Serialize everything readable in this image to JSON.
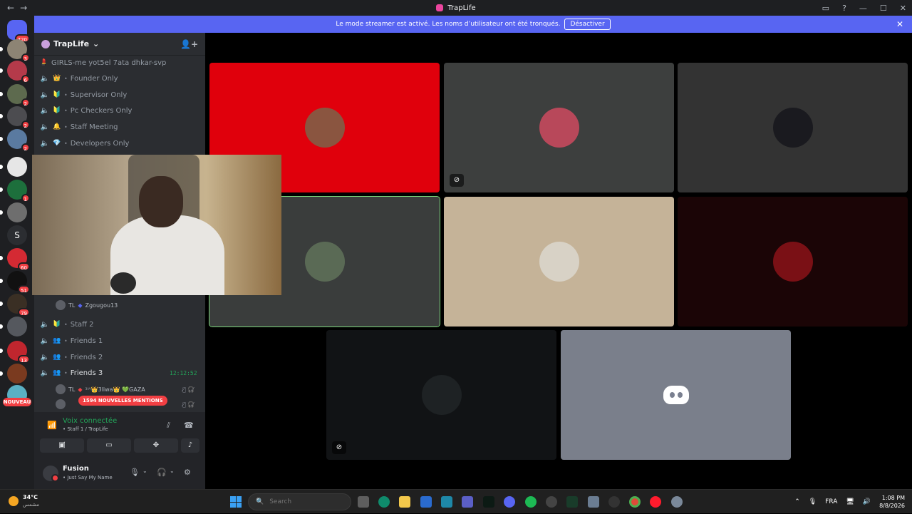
{
  "window": {
    "title": "TrapLife",
    "back": "←",
    "forward": "→",
    "controls": [
      "▭",
      "?",
      "—",
      "☐",
      "✕"
    ]
  },
  "banner": {
    "text": "Le mode streamer est activé. Les noms d’utilisateur ont été tronqués.",
    "button": "Désactiver",
    "close": "✕"
  },
  "servers": {
    "home_badge": "720",
    "new_label": "NOUVEAU",
    "letter": "S",
    "badges": [
      "3",
      "6",
      "2",
      "2",
      "2",
      "1",
      "60",
      "51",
      "79",
      "13"
    ]
  },
  "guild": {
    "name": "TrapLife",
    "chevron": "⌄",
    "channels": [
      {
        "emoji": "💄",
        "name": "GIRLS-me yot5el 7ata dhkar-svp",
        "no_voice": true
      },
      {
        "emoji": "👑",
        "name": "Founder Only"
      },
      {
        "emoji": "🔰",
        "name": "Supervisor Only"
      },
      {
        "emoji": "🔰",
        "name": "Pc Checkers Only"
      },
      {
        "emoji": "🔔",
        "name": "Staff Meeting"
      },
      {
        "emoji": "💎",
        "name": "Developers Only"
      },
      {
        "emoji": "🔰",
        "name": "Staff 2"
      },
      {
        "emoji": "👥",
        "name": "Friends 1"
      },
      {
        "emoji": "👥",
        "name": "Friends 2"
      },
      {
        "emoji": "👥",
        "name": "Friends 3",
        "timer": "12:12:52"
      }
    ],
    "members": [
      {
        "tag": "TL",
        "name": "Zgougou13"
      },
      {
        "tag": "TL",
        "name": "¹ᴵᴬ👑3liwa👑 💚GAZA"
      }
    ],
    "mentions_pill": "1594 NOUVELLES MENTIONS"
  },
  "voice": {
    "status": "Voix connectée",
    "channel": "• Staff 1 / TrapLife",
    "buttons": [
      "camera-off",
      "screen-share",
      "activities",
      "soundboard"
    ]
  },
  "user": {
    "name": "Fusion",
    "status": "• Just Say My Name"
  },
  "stage": {
    "tiles": [
      {
        "bg": "#e0000c",
        "avatar": "#8a5540"
      },
      {
        "bg": "#3d3f3e",
        "avatar": "#b8485a",
        "muted": true
      },
      {
        "bg": "#333333",
        "avatar": "#1a1a1f"
      },
      {
        "bg": "#3a3d3c",
        "avatar": "#5a6a55",
        "speaking": true
      },
      {
        "bg": "#c5b398",
        "avatar": "#d8d2c6"
      },
      {
        "bg": "#1b0506",
        "avatar": "#7a1015"
      },
      {
        "bg": "#111315",
        "avatar": "#1e2224",
        "muted": true
      },
      {
        "bg": "#7a7f8b",
        "discord": true
      }
    ]
  },
  "taskbar": {
    "weather_temp": "34°C",
    "weather_desc": "مشمس",
    "search_placeholder": "Search",
    "lang": "FRA",
    "time": "1:08 PM",
    "date": "8/8/2026",
    "chevron_up": "⌃"
  },
  "colors": {
    "accent": "#5865f2",
    "danger": "#f23f43",
    "online": "#23a559"
  }
}
